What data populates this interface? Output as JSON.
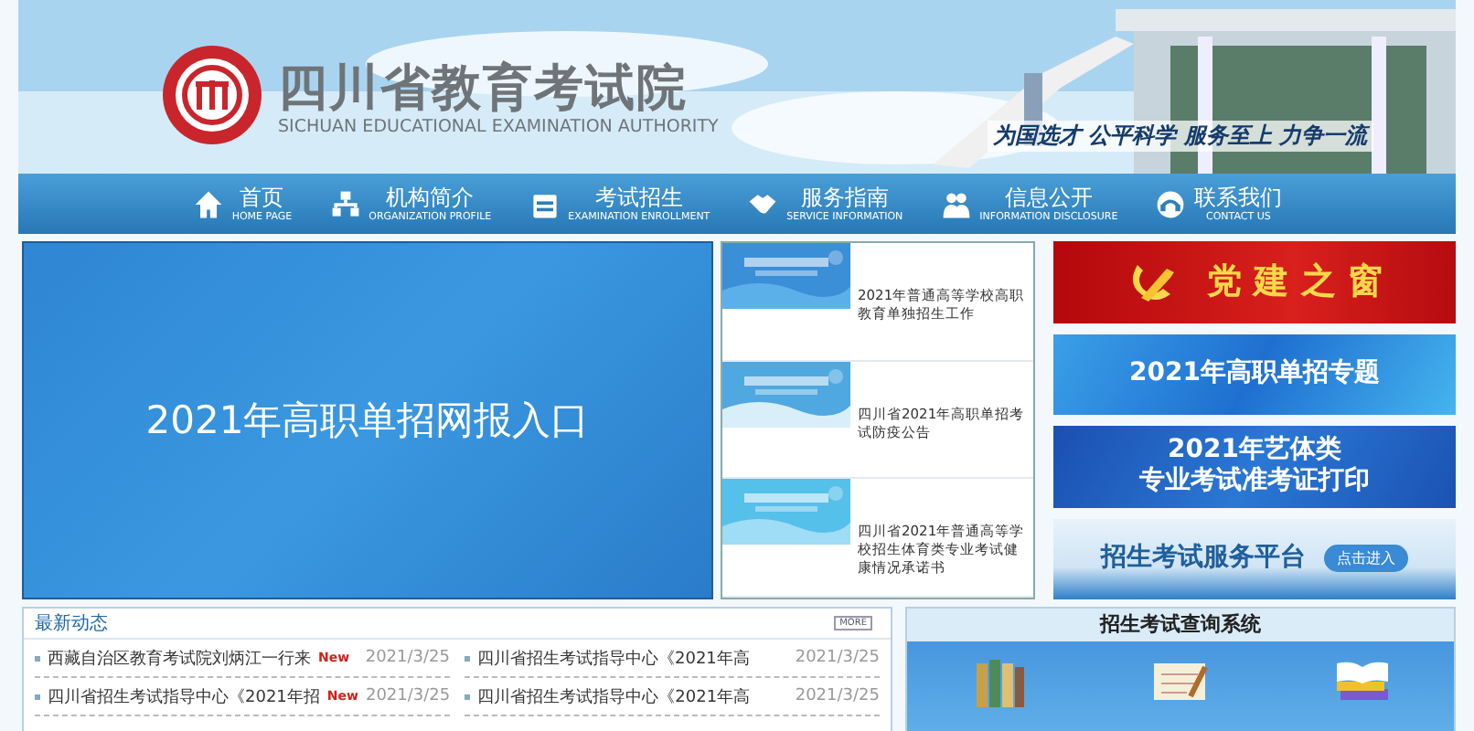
{
  "header": {
    "title": "四川省教育考试院",
    "subtitle": "SICHUAN EDUCATIONAL EXAMINATION AUTHORITY",
    "slogan": "为国选才 公平科学 服务至上 力争一流"
  },
  "nav": [
    {
      "label": "首页",
      "sub": "HOME PAGE"
    },
    {
      "label": "机构简介",
      "sub": "ORGANIZATION PROFILE"
    },
    {
      "label": "考试招生",
      "sub": "EXAMINATION ENROLLMENT"
    },
    {
      "label": "服务指南",
      "sub": "SERVICE INFORMATION"
    },
    {
      "label": "信息公开",
      "sub": "INFORMATION DISCLOSURE"
    },
    {
      "label": "联系我们",
      "sub": "CONTACT US"
    }
  ],
  "banner": {
    "text": "2021年高职单招网报入口"
  },
  "feature_list": [
    {
      "title": "2021年普通高等学校高职教育单独招生工作"
    },
    {
      "title": "四川省2021年高职单招考试防疫公告"
    },
    {
      "title": "四川省2021年普通高等学校招生体育类专业考试健康情况承诺书"
    }
  ],
  "side_banners": [
    {
      "kind": "party",
      "lines": [
        "党 建 之 窗"
      ]
    },
    {
      "kind": "topic",
      "lines": [
        "2021年高职单招专题"
      ]
    },
    {
      "kind": "print",
      "lines": [
        "2021年艺体类",
        "专业考试准考证打印"
      ]
    },
    {
      "kind": "platform",
      "lines": [
        "招生考试服务平台"
      ],
      "button": "点击进入"
    }
  ],
  "news": {
    "title": "最新动态",
    "more": "MORE",
    "rows": [
      [
        {
          "title": "西藏自治区教育考试院刘炳江一行来",
          "badge": "New",
          "date": "2021/3/25"
        },
        {
          "title": "四川省招生考试指导中心《2021年高",
          "date": "2021/3/25"
        }
      ],
      [
        {
          "title": "四川省招生考试指导中心《2021年招",
          "badge": "New",
          "date": "2021/3/25"
        },
        {
          "title": "四川省招生考试指导中心《2021年高",
          "date": "2021/3/25"
        }
      ]
    ]
  },
  "query": {
    "title": "招生考试查询系统"
  }
}
